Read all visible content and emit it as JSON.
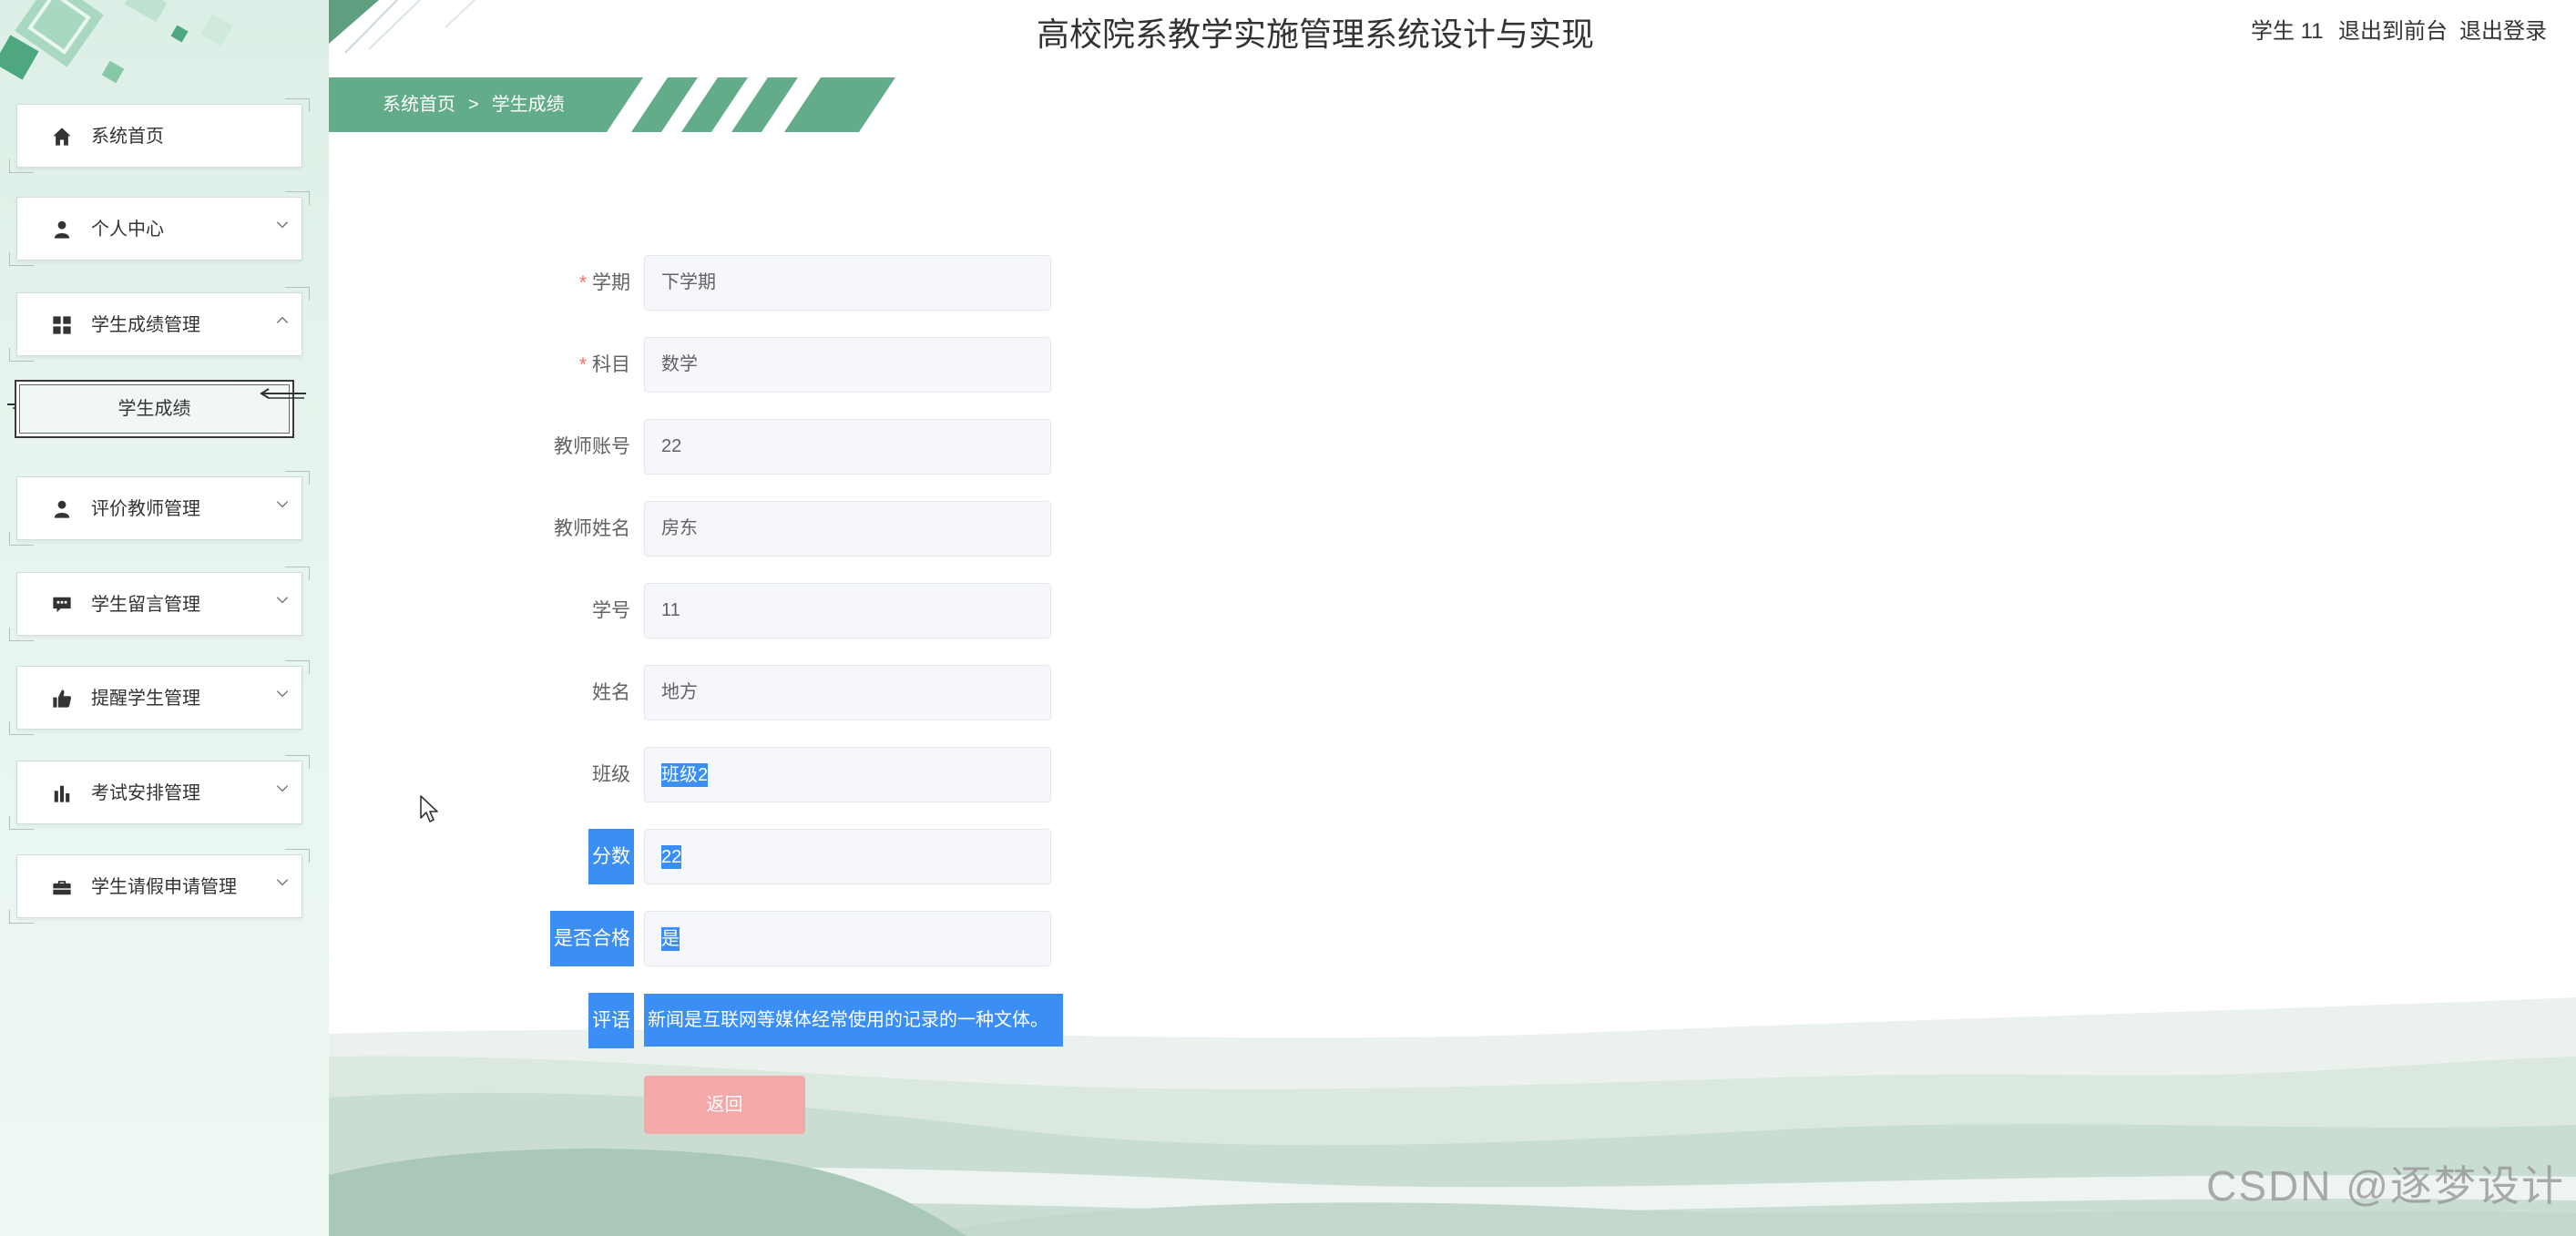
{
  "header": {
    "title": "高校院系教学实施管理系统设计与实现",
    "user_label": "学生 11",
    "to_frontend": "退出到前台",
    "logout": "退出登录"
  },
  "breadcrumb": {
    "home": "系统首页",
    "separator": ">",
    "current": "学生成绩"
  },
  "sidebar": {
    "items": [
      {
        "label": "系统首页",
        "icon": "home-icon"
      },
      {
        "label": "个人中心",
        "icon": "user-icon",
        "chevron": "down"
      },
      {
        "label": "学生成绩管理",
        "icon": "grid-icon",
        "chevron": "up",
        "children": [
          {
            "label": "学生成绩",
            "active": true
          }
        ]
      },
      {
        "label": "评价教师管理",
        "icon": "user-icon",
        "chevron": "down"
      },
      {
        "label": "学生留言管理",
        "icon": "message-icon",
        "chevron": "down"
      },
      {
        "label": "提醒学生管理",
        "icon": "thumbs-up-icon",
        "chevron": "down"
      },
      {
        "label": "考试安排管理",
        "icon": "bar-chart-icon",
        "chevron": "down"
      },
      {
        "label": "学生请假申请管理",
        "icon": "briefcase-icon",
        "chevron": "down"
      }
    ]
  },
  "form": {
    "required_mark": "*",
    "fields": [
      {
        "label": "学期",
        "required": true,
        "value": "下学期"
      },
      {
        "label": "科目",
        "required": true,
        "value": "数学"
      },
      {
        "label": "教师账号",
        "value": "22"
      },
      {
        "label": "教师姓名",
        "value": "房东"
      },
      {
        "label": "学号",
        "value": "11"
      },
      {
        "label": "姓名",
        "value": "地方"
      },
      {
        "label": "班级",
        "value": "班级2",
        "value_selected": true
      },
      {
        "label": "分数",
        "value": "22",
        "label_selected": true,
        "value_selected": true
      },
      {
        "label": "是否合格",
        "value": "是",
        "label_selected": true,
        "value_selected": true
      },
      {
        "label": "评语",
        "value": "新闻是互联网等媒体经常使用的记录的一种文体。",
        "label_selected": true,
        "value_selected": true
      }
    ],
    "button_label": "返回"
  },
  "watermark": "CSDN @逐梦设计",
  "colors": {
    "sidebar_bg": "#e6f4ed",
    "brand_green": "#62ac8a",
    "selection_blue": "#3b8ef3",
    "button_pink": "#f4a8a8",
    "required_red": "#f56c6c"
  }
}
